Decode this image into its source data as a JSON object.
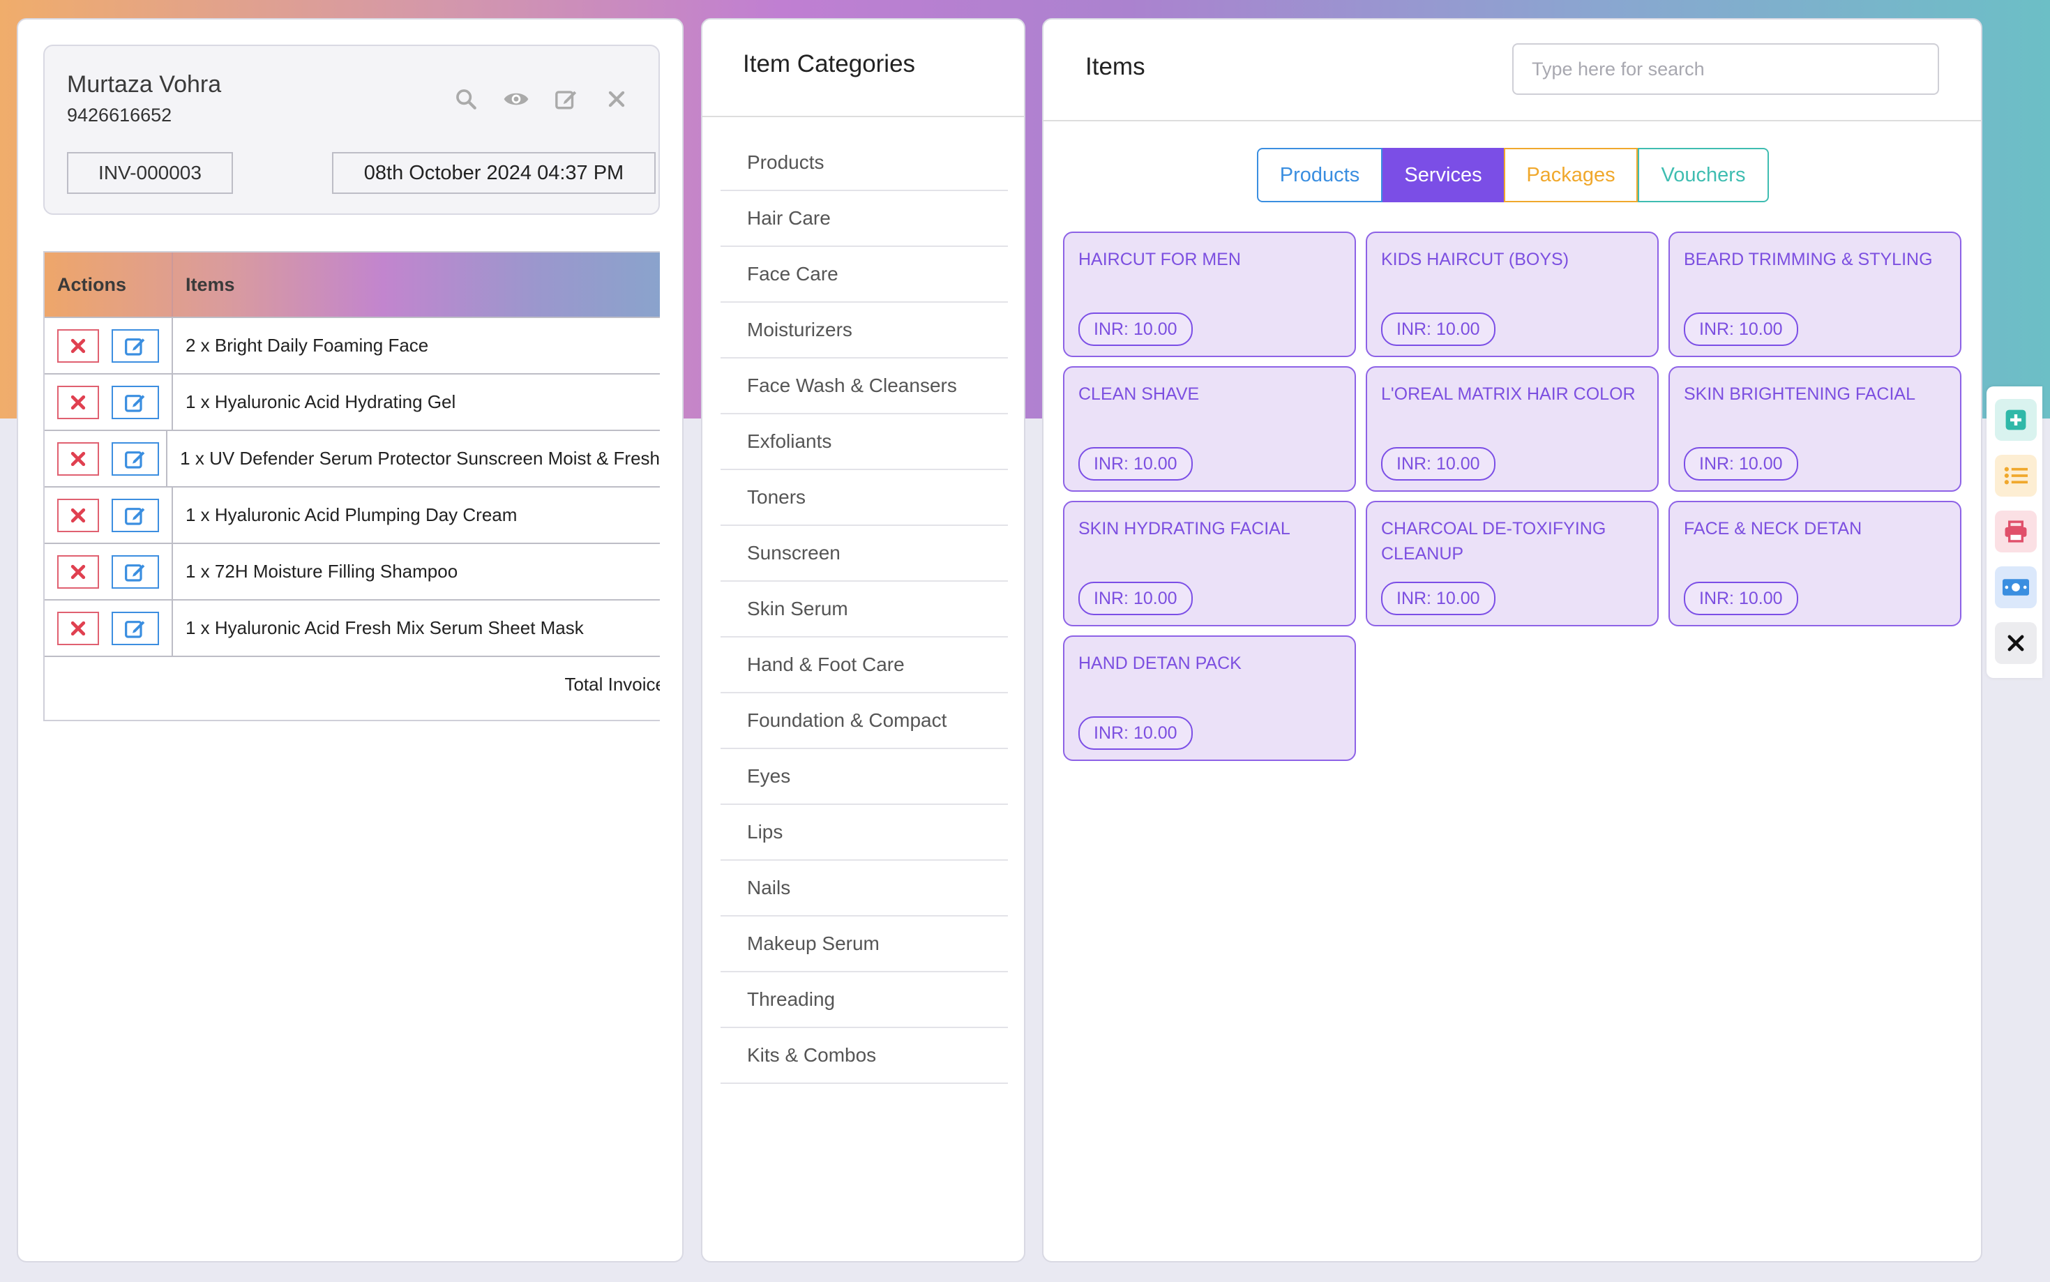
{
  "customer": {
    "name": "Murtaza Vohra",
    "phone": "9426616652",
    "invoice_no": "INV-000003",
    "datetime": "08th October 2024 04:37 PM",
    "icons": [
      "search-icon",
      "eye-icon",
      "edit-icon",
      "close-icon"
    ]
  },
  "cart": {
    "headers": {
      "actions": "Actions",
      "items": "Items"
    },
    "rows": [
      "2 x Bright Daily Foaming Face",
      "1 x Hyaluronic Acid Hydrating Gel",
      "1 x UV Defender Serum Protector Sunscreen Moist & Fresh",
      "1 x Hyaluronic Acid Plumping Day Cream",
      "1 x 72H Moisture Filling Shampoo",
      "1 x Hyaluronic Acid Fresh Mix Serum Sheet Mask"
    ],
    "total_label": "Total Invoice"
  },
  "categories": {
    "title": "Item Categories",
    "items": [
      "Products",
      "Hair Care",
      "Face Care",
      "Moisturizers",
      "Face Wash & Cleansers",
      "Exfoliants",
      "Toners",
      "Sunscreen",
      "Skin Serum",
      "Hand & Foot Care",
      "Foundation & Compact",
      "Eyes",
      "Lips",
      "Nails",
      "Makeup Serum",
      "Threading",
      "Kits & Combos"
    ]
  },
  "items_panel": {
    "title": "Items",
    "search_placeholder": "Type here for search",
    "tabs": {
      "products": "Products",
      "services": "Services",
      "packages": "Packages",
      "vouchers": "Vouchers"
    },
    "active_tab": "Services",
    "services": [
      {
        "name": "HAIRCUT FOR MEN",
        "price": "INR: 10.00"
      },
      {
        "name": "KIDS HAIRCUT (BOYS)",
        "price": "INR: 10.00"
      },
      {
        "name": "BEARD TRIMMING & STYLING",
        "price": "INR: 10.00"
      },
      {
        "name": "CLEAN SHAVE",
        "price": "INR: 10.00"
      },
      {
        "name": "L'OREAL MATRIX HAIR COLOR",
        "price": "INR: 10.00"
      },
      {
        "name": "SKIN BRIGHTENING FACIAL",
        "price": "INR: 10.00"
      },
      {
        "name": "SKIN HYDRATING FACIAL",
        "price": "INR: 10.00"
      },
      {
        "name": "CHARCOAL DE-TOXIFYING CLEANUP",
        "price": "INR: 10.00"
      },
      {
        "name": "FACE & NECK DETAN",
        "price": "INR: 10.00"
      },
      {
        "name": "HAND DETAN PACK",
        "price": "INR: 10.00"
      }
    ]
  },
  "side_actions": [
    "plus-square-icon",
    "list-icon",
    "printer-icon",
    "money-icon",
    "close-icon"
  ],
  "colors": {
    "accent_purple": "#7b4ee6",
    "blue": "#3a8ee0",
    "orange": "#f0a82c",
    "teal": "#3fbdb1",
    "danger": "#e06070"
  }
}
